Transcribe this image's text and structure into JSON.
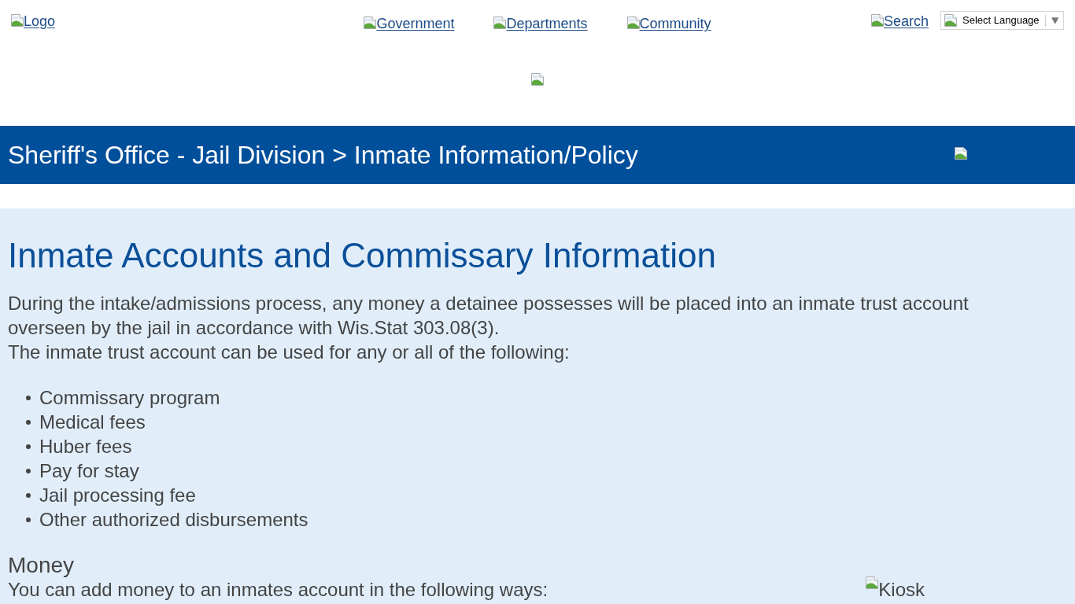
{
  "header": {
    "logo_link": "Logo",
    "nav_links": [
      "Government",
      "Departments",
      "Community"
    ],
    "search_link": "Search",
    "language_select": {
      "value": "Select Language"
    }
  },
  "page_banner": {
    "title": "Sheriff's Office - Jail Division > Inmate Information/Policy"
  },
  "content": {
    "heading": "Inmate Accounts and Commissary Information",
    "paragraphs": [
      "During the intake/admissions process, any money a detainee possesses will be placed into an inmate trust account overseen by the jail in accordance with Wis.Stat 303.08(3).",
      "The inmate trust account can be used for any or all of the following:"
    ],
    "uses": [
      "Commissary program",
      "Medical fees",
      "Huber fees",
      "Pay for stay",
      "Jail processing fee",
      "Other authorized disbursements"
    ],
    "money_section": {
      "heading": "Money",
      "text": "You can add money to an inmates account in the following ways:",
      "image_alt": "Kiosk"
    }
  }
}
